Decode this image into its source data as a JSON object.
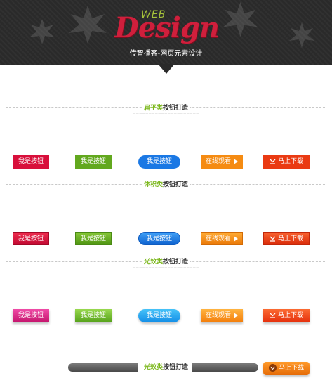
{
  "header": {
    "logo_small": "WEB",
    "logo_big": "Design",
    "subtitle": "传智播客-网页元素设计"
  },
  "sections": [
    {
      "highlight": "扁平类",
      "rest": "按钮打造",
      "sub": "—————————————————————"
    },
    {
      "highlight": "体积类",
      "rest": "按钮打造",
      "sub": "—————————————————————"
    },
    {
      "highlight": "光效类",
      "rest": "按钮打造",
      "sub": "—————————————————————"
    },
    {
      "highlight": "光效类",
      "rest": "按钮打造",
      "sub": "—————————————————————"
    }
  ],
  "buttons": {
    "primary": "我是按钮",
    "watch_online": "在线观看",
    "download": "马上下载"
  },
  "colors": {
    "header_bg": "#2a2a2a",
    "accent_green": "#7db81f",
    "flat_red": "#d80f3b",
    "flat_green": "#62a81e",
    "flat_blue": "#1a78e4",
    "flat_orange": "#f58b12",
    "flat_download": "#ea3a12"
  },
  "icons": [
    "play-triangle-icon",
    "download-icon",
    "chevron-circle-down-icon",
    "leaf-decoration-icon"
  ]
}
